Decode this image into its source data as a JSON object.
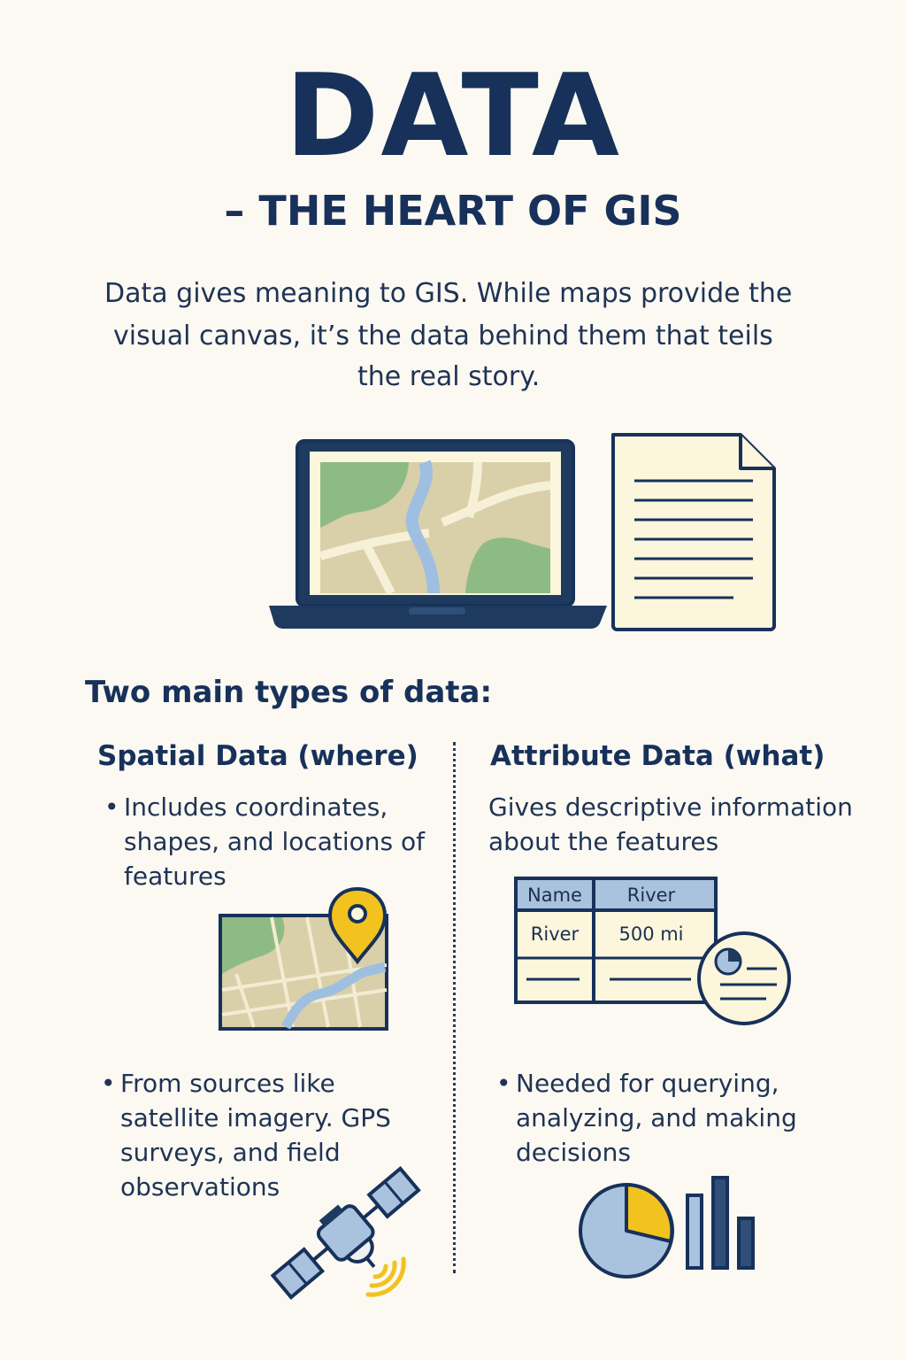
{
  "header": {
    "title": "DATA",
    "subtitle": "– THE HEART OF GIS"
  },
  "intro": {
    "line1": "Data gives meaning to GIS. While maps provide the",
    "line2": "visual canvas, it’s the data behind them that teils",
    "line3": "the real story."
  },
  "types": {
    "heading": "Two main types of data:",
    "spatial": {
      "heading": "Spatial Data (where)",
      "bullet1": "Includes coordinates, shapes, and locations of features",
      "bullet2": "From sources like satellite imagery. GPS surveys, and field observations"
    },
    "attribute": {
      "heading": "Attribute Data (what)",
      "description": "Gives descriptive information about the features",
      "table": {
        "headers": [
          "Name",
          "River"
        ],
        "rows": [
          [
            "River",
            "500 mi"
          ]
        ]
      },
      "bullet2": "Needed for querying, analyzing, and making decisions"
    }
  },
  "colors": {
    "navy": "#17315a",
    "green": "#8ebb84",
    "tan": "#d9cfa9",
    "water": "#9fbfe0",
    "yellow": "#f2c21e",
    "paper": "#fbf6dc",
    "background": "#fbf9f2"
  },
  "icons": [
    "laptop-map-icon",
    "document-icon",
    "map-pin-icon",
    "table-icon",
    "chart-badge-icon",
    "satellite-icon",
    "pie-chart-icon",
    "bar-chart-icon"
  ]
}
